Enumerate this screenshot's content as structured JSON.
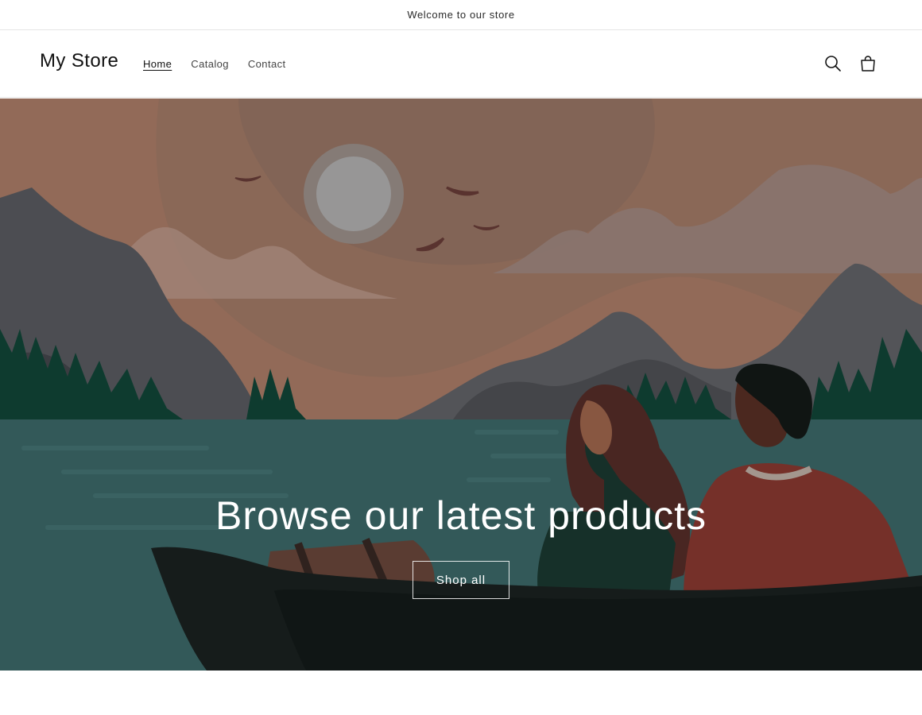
{
  "announcement": {
    "text": "Welcome to our store"
  },
  "header": {
    "logo": "My Store",
    "nav": [
      {
        "label": "Home",
        "active": true
      },
      {
        "label": "Catalog",
        "active": false
      },
      {
        "label": "Contact",
        "active": false
      }
    ],
    "icons": {
      "search": "search-icon",
      "cart": "cart-icon"
    }
  },
  "hero": {
    "heading": "Browse our latest products",
    "button_label": "Shop all"
  },
  "colors": {
    "sky": "#b98a74",
    "water": "#3f6d6d",
    "boat": "#1b2321",
    "text_light": "#ffffff"
  }
}
